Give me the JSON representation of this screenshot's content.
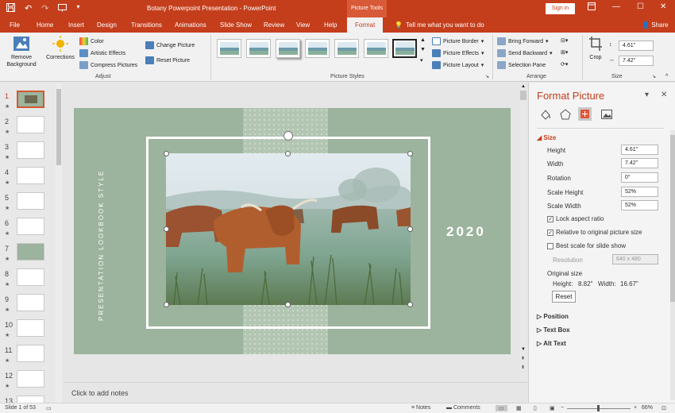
{
  "titlebar": {
    "title": "Botany Powerpoint Presentation  -  PowerPoint",
    "context_tab": "Picture Tools",
    "sign_in": "Sign in"
  },
  "tabs": [
    "File",
    "Home",
    "Insert",
    "Design",
    "Transitions",
    "Animations",
    "Slide Show",
    "Review",
    "View",
    "Help",
    "Format"
  ],
  "active_tab": "Format",
  "tell_me": "Tell me what you want to do",
  "share": "Share",
  "ribbon": {
    "remove_background": "Remove Background",
    "corrections": "Corrections",
    "color": "Color",
    "artistic_effects": "Artistic Effects",
    "compress_pictures": "Compress Pictures",
    "change_picture": "Change Picture",
    "reset_picture": "Reset Picture",
    "group_adjust": "Adjust",
    "group_picture_styles": "Picture Styles",
    "picture_border": "Picture Border",
    "picture_effects": "Picture Effects",
    "picture_layout": "Picture Layout",
    "bring_forward": "Bring Forward",
    "send_backward": "Send Backward",
    "selection_pane": "Selection Pane",
    "group_arrange": "Arrange",
    "crop": "Crop",
    "height": "4.61\"",
    "width": "7.42\"",
    "group_size": "Size"
  },
  "thumbnails": [
    "1",
    "2",
    "3",
    "4",
    "5",
    "6",
    "7",
    "8",
    "9",
    "10",
    "11",
    "12",
    "13"
  ],
  "selected_slide": "1",
  "slide": {
    "vertical_text": "PRESENTATION LOOKBOOK STYLE",
    "year": "2020"
  },
  "notes_placeholder": "Click to add notes",
  "pane": {
    "title": "Format Picture",
    "size_section": "Size",
    "height_label": "Height",
    "height_value": "4.61\"",
    "width_label": "Width",
    "width_value": "7.42\"",
    "rotation_label": "Rotation",
    "rotation_value": "0°",
    "scale_height_label": "Scale Height",
    "scale_height_value": "52%",
    "scale_width_label": "Scale Width",
    "scale_width_value": "52%",
    "lock_aspect": "Lock aspect ratio",
    "relative_original": "Relative to original picture size",
    "best_scale": "Best scale for slide show",
    "resolution_label": "Resolution",
    "resolution_value": "640 x 480",
    "original_size": "Original size",
    "original_height_label": "Height:",
    "original_height_value": "8.82\"",
    "original_width_label": "Width:",
    "original_width_value": "16.67\"",
    "reset": "Reset",
    "position_section": "Position",
    "text_box_section": "Text Box",
    "alt_text_section": "Alt Text"
  },
  "status": {
    "slide_info": "Slide 1 of 53",
    "notes": "Notes",
    "comments": "Comments",
    "zoom": "66%"
  },
  "colors": {
    "accent": "#c43e1c",
    "slide_bg": "#9cb39d"
  }
}
